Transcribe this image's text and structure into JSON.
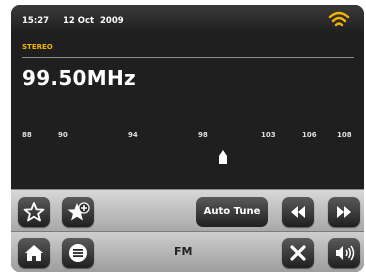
{
  "status": {
    "time": "15:27",
    "date": "12 Oct",
    "year": "2009",
    "wifi_icon": "wifi-icon"
  },
  "radio": {
    "mode": "STEREO",
    "frequency": "99.50MHz",
    "scale_ticks": [
      "88",
      "90",
      "94",
      "98",
      "103",
      "106",
      "108"
    ],
    "source": "FM"
  },
  "toolbar": {
    "favorite_icon": "star-icon",
    "add_favorite_icon": "star-add-icon",
    "autotune_label": "Auto Tune",
    "rewind_icon": "rewind-icon",
    "fast_forward_icon": "fast-forward-icon",
    "home_icon": "home-icon",
    "menu_icon": "menu-icon",
    "close_icon": "close-icon",
    "volume_icon": "volume-icon"
  },
  "colors": {
    "accent": "#f2b500",
    "screen_bg": "#1f1f1f",
    "button_bg": "#2e2e2e"
  }
}
